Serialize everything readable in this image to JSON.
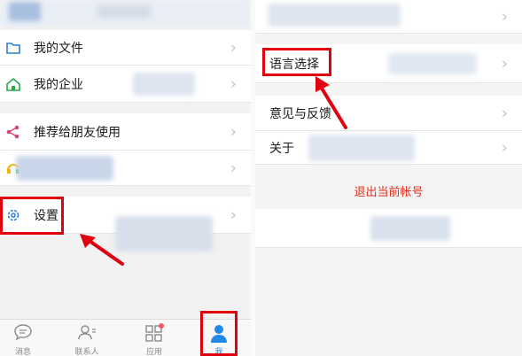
{
  "left_menu": {
    "items": [
      {
        "label": "我的文件"
      },
      {
        "label": "我的企业"
      },
      {
        "label": "推荐给朋友使用"
      },
      {
        "label": "设置"
      }
    ]
  },
  "tabbar": {
    "tabs": [
      {
        "label": "消息"
      },
      {
        "label": "联系人"
      },
      {
        "label": "应用"
      },
      {
        "label": "我"
      }
    ]
  },
  "right_menu": {
    "items": [
      {
        "label": "语言选择"
      },
      {
        "label": "意见与反馈"
      },
      {
        "label": "关于"
      }
    ],
    "logout_label": "退出当前帐号"
  },
  "colors": {
    "accent_red": "#e0000e",
    "active_tab": "#1f8ae8",
    "logout_red": "#e0301e"
  }
}
